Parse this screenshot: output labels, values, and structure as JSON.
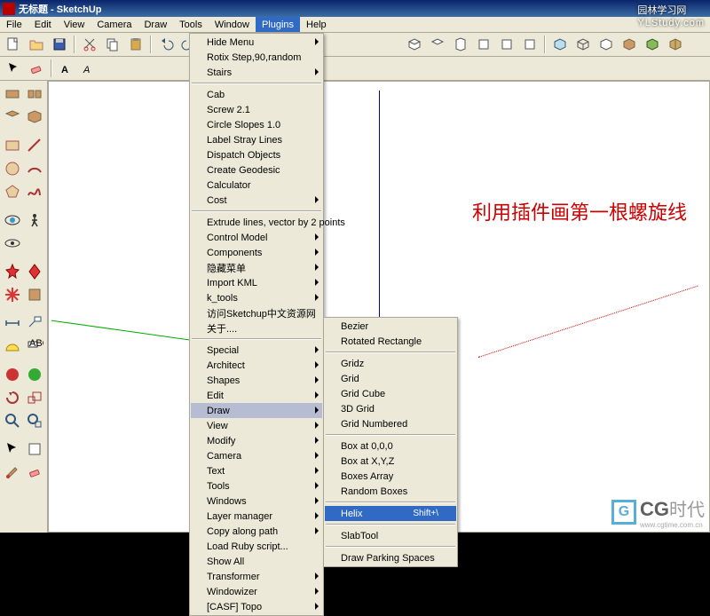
{
  "title": "无标题 - SketchUp",
  "menubar": [
    "File",
    "Edit",
    "View",
    "Camera",
    "Draw",
    "Tools",
    "Window",
    "Plugins",
    "Help"
  ],
  "menubar_active_index": 7,
  "annotation": "利用插件画第一根螺旋线",
  "watermark1": {
    "cn": "园林学习网",
    "en": "YLStudy.com"
  },
  "watermark2": {
    "brand": "CG",
    "cn": "时代",
    "url": "www.cgtime.com.cn"
  },
  "menu1": [
    {
      "label": "Hide Menu",
      "arrow": true
    },
    {
      "label": "Rotix Step,90,random"
    },
    {
      "label": "Stairs",
      "arrow": true
    },
    {
      "sep": true
    },
    {
      "label": "Cab"
    },
    {
      "label": "Screw 2.1"
    },
    {
      "label": "Circle Slopes 1.0"
    },
    {
      "label": "Label Stray Lines"
    },
    {
      "label": "Dispatch Objects"
    },
    {
      "label": "Create Geodesic"
    },
    {
      "label": "Calculator"
    },
    {
      "label": "Cost",
      "arrow": true
    },
    {
      "sep": true
    },
    {
      "label": "Extrude lines, vector by 2 points"
    },
    {
      "label": "Control Model",
      "arrow": true
    },
    {
      "label": "Components",
      "arrow": true
    },
    {
      "label": "隐藏菜单",
      "arrow": true
    },
    {
      "label": "Import KML",
      "arrow": true
    },
    {
      "label": "k_tools",
      "arrow": true
    },
    {
      "label": "访问Sketchup中文资源网"
    },
    {
      "label": "关于...."
    },
    {
      "sep": true
    },
    {
      "label": "Special",
      "arrow": true
    },
    {
      "label": "Architect",
      "arrow": true
    },
    {
      "label": "Shapes",
      "arrow": true
    },
    {
      "label": "Edit",
      "arrow": true
    },
    {
      "label": "Draw",
      "arrow": true,
      "hl": "hl2"
    },
    {
      "label": "View",
      "arrow": true
    },
    {
      "label": "Modify",
      "arrow": true
    },
    {
      "label": "Camera",
      "arrow": true
    },
    {
      "label": "Text",
      "arrow": true
    },
    {
      "label": "Tools",
      "arrow": true
    },
    {
      "label": "Windows",
      "arrow": true
    },
    {
      "label": "Layer manager",
      "arrow": true
    },
    {
      "label": "Copy along path",
      "arrow": true
    },
    {
      "label": "Load Ruby script..."
    },
    {
      "label": "Show All"
    },
    {
      "label": "Transformer",
      "arrow": true
    },
    {
      "label": "Windowizer",
      "arrow": true
    },
    {
      "label": "[CASF] Topo",
      "arrow": true
    }
  ],
  "menu2": [
    {
      "label": "Bezier"
    },
    {
      "label": "Rotated Rectangle"
    },
    {
      "sep": true
    },
    {
      "label": "Gridz"
    },
    {
      "label": "Grid"
    },
    {
      "label": "Grid Cube"
    },
    {
      "label": "3D Grid"
    },
    {
      "label": "Grid Numbered"
    },
    {
      "sep": true
    },
    {
      "label": "Box at 0,0,0"
    },
    {
      "label": "Box at X,Y,Z"
    },
    {
      "label": "Boxes Array"
    },
    {
      "label": "Random Boxes"
    },
    {
      "sep": true
    },
    {
      "label": "Helix",
      "accel": "Shift+\\",
      "hl": "hl"
    },
    {
      "sep": true
    },
    {
      "label": "SlabTool"
    },
    {
      "sep": true
    },
    {
      "label": "Draw Parking Spaces"
    }
  ]
}
